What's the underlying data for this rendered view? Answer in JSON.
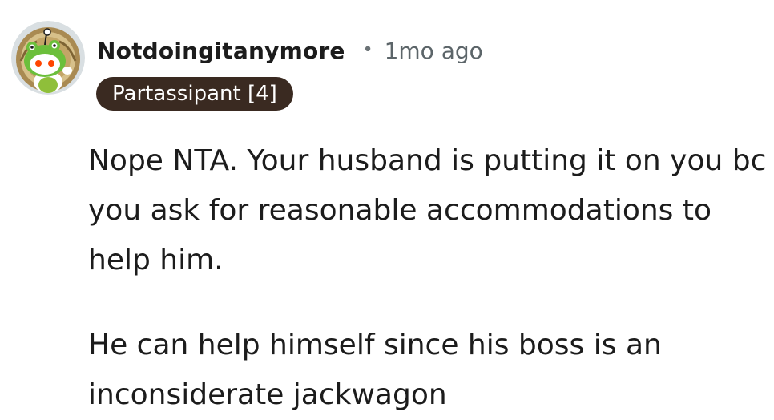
{
  "comment": {
    "username": "Notdoingitanymore",
    "separator": "•",
    "timestamp": "1mo ago",
    "flair": "Partassipant [4]",
    "avatar_icon": "snoo-avatar-icon",
    "paragraphs": [
      "Nope NTA. Your husband is putting it on you bc you ask for reasonable accommodations to help him.",
      "He can help himself since his boss is an inconsiderate jackwagon"
    ]
  },
  "colors": {
    "text": "#1c1c1c",
    "muted": "#5c6569",
    "flair_bg": "#3a2a21",
    "flair_text": "#ffffff"
  }
}
